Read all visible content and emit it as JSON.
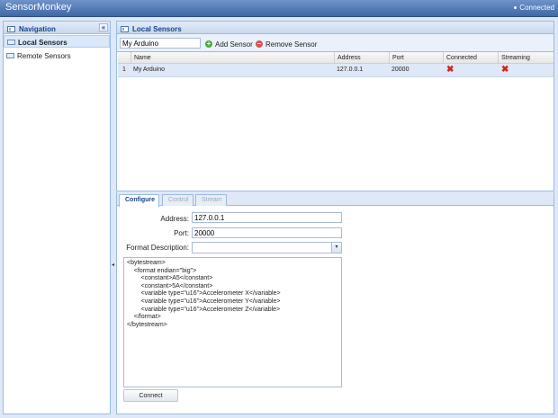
{
  "app": {
    "title": "SensorMonkey",
    "status": "Connected"
  },
  "nav": {
    "title": "Navigation",
    "collapse_glyph": "«",
    "items": [
      {
        "label": "Local Sensors",
        "icon": "sensor-icon",
        "selected": true
      },
      {
        "label": "Remote Sensors",
        "icon": "sensor-icon",
        "selected": false
      }
    ]
  },
  "splitter": {
    "glyph": "◂"
  },
  "local": {
    "title": "Local Sensors",
    "toolbar": {
      "name_value": "My Arduino",
      "add_label": "Add Sensor",
      "add_icon": "add-icon",
      "remove_label": "Remove Sensor",
      "remove_icon": "remove-icon"
    },
    "grid": {
      "columns": [
        "Name",
        "Address",
        "Port",
        "Connected",
        "Streaming"
      ],
      "rows": [
        {
          "index": "1",
          "name": "My Arduino",
          "address": "127.0.0.1",
          "port": "20000",
          "connected": "✖",
          "streaming": "✖"
        }
      ]
    }
  },
  "tabs": [
    {
      "label": "Configure",
      "active": true
    },
    {
      "label": "Control",
      "active": false
    },
    {
      "label": "Stream",
      "active": false
    }
  ],
  "config": {
    "address_label": "Address:",
    "address_value": "127.0.0.1",
    "port_label": "Port:",
    "port_value": "20000",
    "format_label": "Format Description:",
    "format_value": "",
    "format_glyph": "▾",
    "xml": "<bytestream>\n    <format endian=\"big\">\n        <constant>A5</constant>\n        <constant>5A</constant>\n        <variable type=\"u16\">Accelerometer X</variable>\n        <variable type=\"u16\">Accelerometer Y</variable>\n        <variable type=\"u16\">Accelerometer Z</variable>\n    </format>\n</bytestream>",
    "connect_label": "Connect"
  },
  "colors": {
    "accent": "#15428b",
    "header": "#3f68a6",
    "error": "#d42020"
  }
}
